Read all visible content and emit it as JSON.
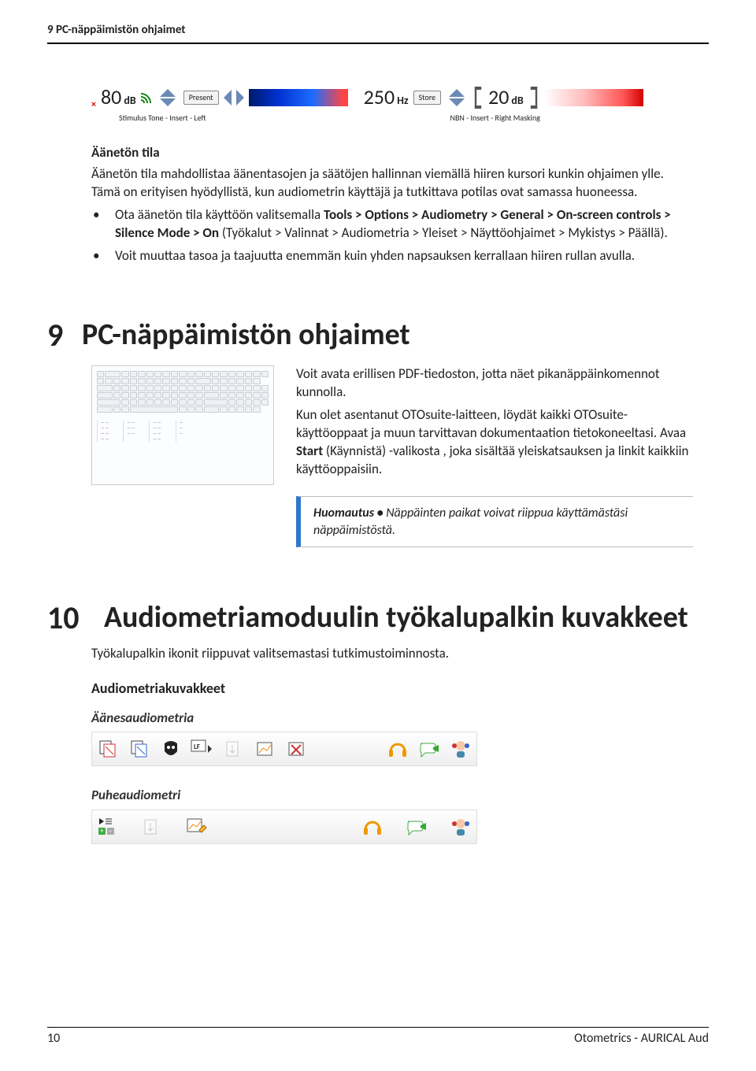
{
  "header": {
    "running_head": "9 PC-näppäimistön ohjaimet"
  },
  "strip": {
    "stimulus_db": "80",
    "stimulus_unit": "dB",
    "btn_present": "Present",
    "freq_value": "250",
    "freq_unit": "Hz",
    "btn_store": "Store",
    "mask_db": "20",
    "mask_unit": "dB",
    "left_label": "Stimulus  Tone - Insert - Left",
    "right_label": "NBN - Insert - Right  Masking"
  },
  "silence": {
    "heading": "Äänetön tila",
    "p1": "Äänetön tila mahdollistaa äänentasojen ja säätöjen hallinnan viemällä hiiren kursori kunkin ohjaimen ylle. Tämä on erityisen hyödyllistä, kun audiometrin käyttäjä ja tutkittava potilas ovat samassa huoneessa.",
    "b1_pre": "Ota äänetön tila käyttöön valitsemalla ",
    "b1_bold1": "Tools  > Options > Audiometry > General > On-screen controls > Silence Mode > On",
    "b1_mid": " (Työkalut > Valinnat > Audiometria > Yleiset > Näyttöohjaimet > Mykistys > Päällä).",
    "b2": "Voit muuttaa tasoa ja taajuutta enemmän kuin yhden napsauksen kerrallaan hiiren rullan avulla."
  },
  "sec9": {
    "num": "9",
    "title": "PC-näppäimistön ohjaimet",
    "p1": "Voit avata erillisen PDF-tiedoston, jotta näet pikanäppäinkomennot kunnolla.",
    "p2_a": "Kun olet asentanut OTOsuite-laitteen, löydät kaikki OTOsuite-käyttöoppaat ja muun tarvittavan dokumentaation tietokoneeltasi. Avaa ",
    "p2_bold": "Start",
    "p2_b": " (Käynnistä) -valikosta , joka sisältää yleiskatsauksen ja linkit kaikkiin käyttöoppaisiin.",
    "note_bold": "Huomautus • ",
    "note_rest": "Näppäinten paikat voivat riippua käyttämästäsi näppäimistöstä."
  },
  "sec10": {
    "num": "10",
    "title": "Audiometriamoduulin työkalupalkin kuvakkeet",
    "intro": "Työkalupalkin ikonit riippuvat valitsemastasi tutkimustoiminnosta.",
    "sub": "Audiometriakuvakkeet",
    "cat1": "Äänesaudiometria",
    "cat2": "Puheaudiometri"
  },
  "footer": {
    "page": "10",
    "product": "Otometrics - AURICAL Aud"
  }
}
